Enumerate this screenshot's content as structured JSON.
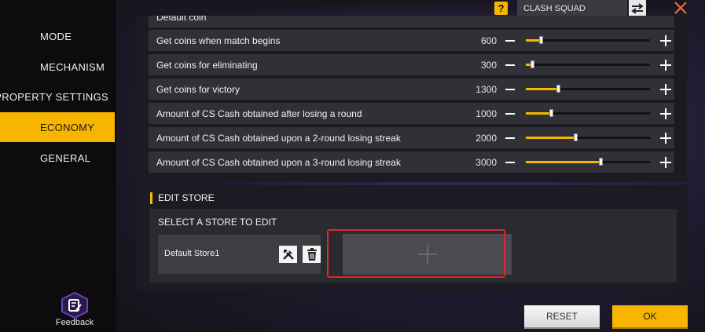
{
  "sidebar": {
    "items": [
      {
        "label": "MODE",
        "active": false
      },
      {
        "label": "MECHANISM",
        "active": false
      },
      {
        "label": "PROPERTY SETTINGS",
        "active": false
      },
      {
        "label": "ECONOMY",
        "active": true
      },
      {
        "label": "GENERAL",
        "active": false
      }
    ],
    "feedback_label": "Feedback"
  },
  "topbar": {
    "help_label": "?",
    "mode_value": "CLASH SQUAD"
  },
  "economy": {
    "partial_row_label": "Default coin",
    "rows": [
      {
        "label": "Get coins when match begins",
        "value": "600",
        "fill": 0.12
      },
      {
        "label": "Get coins for eliminating",
        "value": "300",
        "fill": 0.05
      },
      {
        "label": "Get coins for victory",
        "value": "1300",
        "fill": 0.26
      },
      {
        "label": "Amount of CS Cash obtained after losing a round",
        "value": "1000",
        "fill": 0.2
      },
      {
        "label": "Amount of CS Cash obtained upon a 2-round losing streak",
        "value": "2000",
        "fill": 0.4
      },
      {
        "label": "Amount of CS Cash obtained upon a 3-round losing streak",
        "value": "3000",
        "fill": 0.6
      }
    ]
  },
  "store": {
    "section_title": "EDIT STORE",
    "select_label": "SELECT A STORE TO EDIT",
    "stores": [
      {
        "name": "Default Store1"
      }
    ]
  },
  "buttons": {
    "reset": "RESET",
    "ok": "OK"
  },
  "colors": {
    "accent": "#f7b500",
    "highlight": "#e0282a"
  }
}
